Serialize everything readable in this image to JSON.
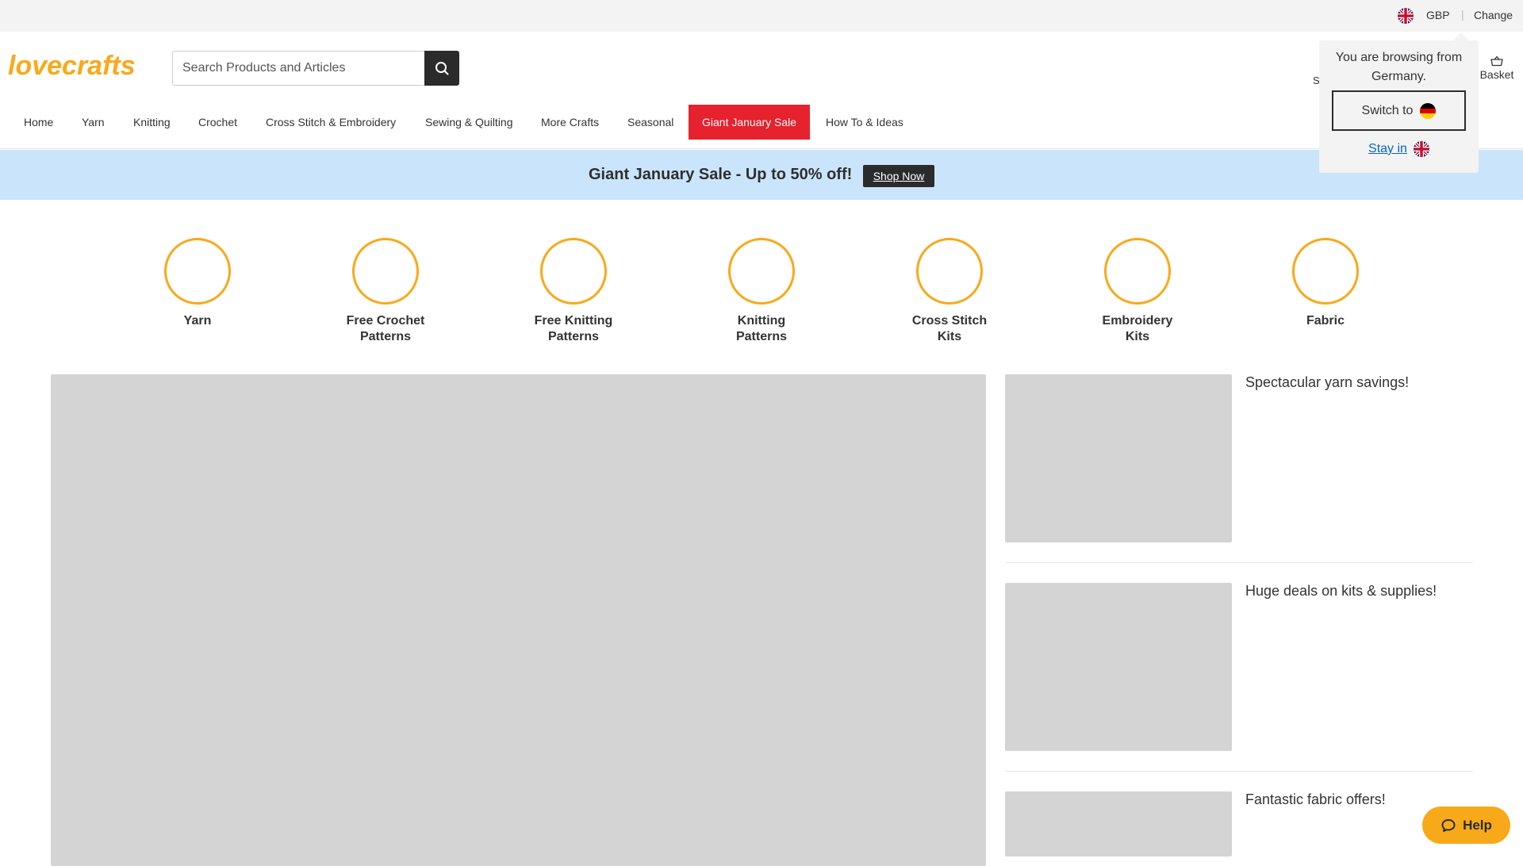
{
  "top_bar": {
    "currency": "GBP",
    "separator": "|",
    "change_label": "Change"
  },
  "header": {
    "brand": "lovecrafts",
    "search_placeholder": "Search Products and Articles",
    "sign_in_partial": "S",
    "basket_label": "Basket"
  },
  "nav": {
    "items": [
      "Home",
      "Yarn",
      "Knitting",
      "Crochet",
      "Cross Stitch & Embroidery",
      "Sewing & Quilting",
      "More Crafts",
      "Seasonal",
      "Giant January Sale",
      "How To & Ideas"
    ]
  },
  "banner": {
    "text": "Giant January Sale - Up to 50% off!",
    "button_label": "Shop Now",
    "background": "#cae5fb"
  },
  "categories": [
    {
      "line1": "Yarn",
      "line2": ""
    },
    {
      "line1": "Free Crochet",
      "line2": "Patterns"
    },
    {
      "line1": "Free Knitting",
      "line2": "Patterns"
    },
    {
      "line1": "Knitting",
      "line2": "Patterns"
    },
    {
      "line1": "Cross Stitch",
      "line2": "Kits"
    },
    {
      "line1": "Embroidery",
      "line2": "Kits"
    },
    {
      "line1": "Fabric",
      "line2": ""
    }
  ],
  "promos": [
    "Spectacular yarn savings!",
    "Huge deals on kits & supplies!",
    "Fantastic fabric offers!"
  ],
  "region_popup": {
    "line1": "You are browsing from",
    "line2": "Germany.",
    "switch_label": "Switch to",
    "stay_label": "Stay in"
  },
  "help": {
    "label": "Help"
  },
  "colors": {
    "accent": "#f8a91a",
    "sale": "#e5222e",
    "dark": "#2b2b2b",
    "link": "#0a66c2"
  }
}
